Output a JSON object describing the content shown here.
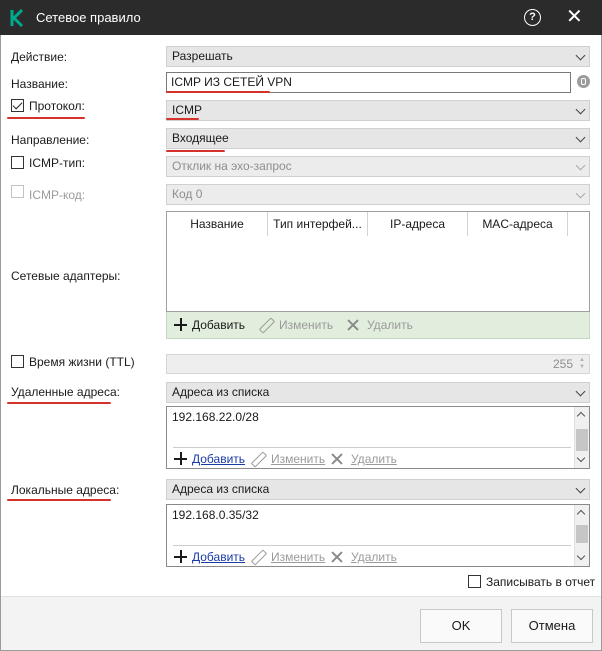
{
  "window": {
    "title": "Сетевое правило"
  },
  "fields": {
    "action": {
      "label": "Действие:",
      "value": "Разрешать"
    },
    "name": {
      "label": "Название:",
      "value": "ICMP ИЗ СЕТЕЙ VPN"
    },
    "protocol": {
      "label": "Протокол:",
      "value": "ICMP",
      "checked": true
    },
    "direction": {
      "label": "Направление:",
      "value": "Входящее"
    },
    "icmp_type": {
      "label": "ICMP-тип:",
      "value": "Отклик на эхо-запрос",
      "checked": false
    },
    "icmp_code": {
      "label": "ICMP-код:",
      "value": "Код 0",
      "checked": false
    },
    "adapters": {
      "label": "Сетевые адаптеры:",
      "columns": [
        "Название",
        "Тип интерфей...",
        "IP-адреса",
        "MAC-адреса"
      ],
      "rows": []
    },
    "ttl": {
      "label": "Время жизни (TTL)",
      "value": "255",
      "checked": false
    },
    "remote": {
      "label": "Удаленные адреса:",
      "value": "Адреса из списка",
      "entries": [
        "192.168.22.0/28"
      ]
    },
    "local": {
      "label": "Локальные адреса:",
      "value": "Адреса из списка",
      "entries": [
        "192.168.0.35/32"
      ]
    },
    "log": {
      "label": "Записывать в отчет",
      "checked": false
    }
  },
  "toolbar": {
    "add": "Добавить",
    "edit": "Изменить",
    "delete": "Удалить"
  },
  "buttons": {
    "ok": "OK",
    "cancel": "Отмена"
  },
  "colors": {
    "titlebar": "#2b2b2b",
    "logo": "#00a88e",
    "highlight": "#d6322c",
    "link": "#1a3aa6",
    "table_toolbar": "#e1eedd"
  },
  "icons": [
    "kaspersky-logo",
    "help-icon",
    "close-icon",
    "info-icon",
    "plus-icon",
    "pencil-icon",
    "x-icon"
  ]
}
